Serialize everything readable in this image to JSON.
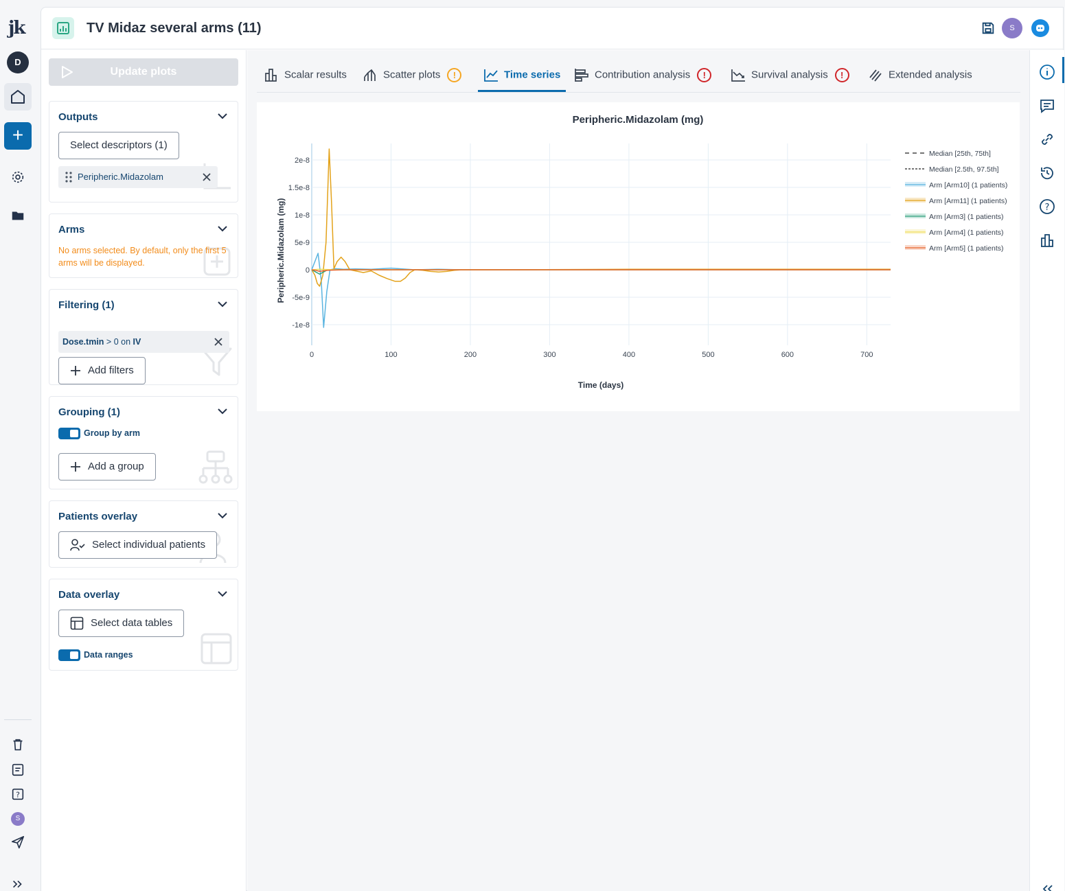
{
  "rail": {
    "logo": "jk",
    "user_initial": "D",
    "footer_user_initial": "S"
  },
  "header": {
    "title": "TV Midaz several arms (11)",
    "user_initial": "S"
  },
  "sidebar": {
    "update_label": "Update plots",
    "outputs": {
      "title": "Outputs",
      "select_label": "Select descriptors (1)",
      "chip": "Peripheric.Midazolam"
    },
    "arms": {
      "title": "Arms",
      "warning": "No arms selected. By default, only the first 5 arms will be displayed."
    },
    "filtering": {
      "title": "Filtering (1)",
      "filter_field": "Dose.tmin",
      "filter_op": "> 0 on",
      "filter_value": "IV",
      "add_label": "Add filters"
    },
    "grouping": {
      "title": "Grouping (1)",
      "toggle_label": "Group by arm",
      "add_label": "Add a group"
    },
    "patients_overlay": {
      "title": "Patients overlay",
      "select_label": "Select individual patients"
    },
    "data_overlay": {
      "title": "Data overlay",
      "select_label": "Select data tables",
      "toggle_label": "Data ranges"
    }
  },
  "tabs": [
    {
      "label": "Scalar results",
      "badge": ""
    },
    {
      "label": "Scatter plots",
      "badge": "!"
    },
    {
      "label": "Time series",
      "badge": ""
    },
    {
      "label": "Contribution analysis",
      "badge": "!"
    },
    {
      "label": "Survival analysis",
      "badge": "!"
    },
    {
      "label": "Extended analysis",
      "badge": ""
    }
  ],
  "colors": {
    "accent": "#0b6bad",
    "warning": "#f5a623",
    "error": "#d0262a",
    "arm10": "#5ab4e0",
    "arm11": "#e3a21a",
    "arm3": "#2ca07c",
    "arm4": "#f0dd5a",
    "arm5": "#e8632b"
  },
  "chart_data": {
    "type": "line",
    "title": "Peripheric.Midazolam (mg)",
    "xlabel": "Time (days)",
    "ylabel": "Peripheric.Midazolam (mg)",
    "xlim": [
      0,
      730
    ],
    "ylim": [
      -1.3e-08,
      2.3e-08
    ],
    "xticks": [
      0,
      100,
      200,
      300,
      400,
      500,
      600,
      700
    ],
    "xtick_labels": [
      "0",
      "100",
      "200",
      "300",
      "400",
      "500",
      "600",
      "700"
    ],
    "yticks": [
      2e-08,
      1.5e-08,
      1e-08,
      5e-09,
      0,
      -5e-09,
      -1e-08
    ],
    "ytick_labels": [
      "2e-8",
      "1.5e-8",
      "1e-8",
      "5e-9",
      "0",
      "-5e-9",
      "-1e-8"
    ],
    "grid": true,
    "legend_position": "right",
    "legend": [
      {
        "label": "Median [25th, 75th]",
        "style": "dash",
        "color": "#222222"
      },
      {
        "label": "Median [2.5th, 97.5th]",
        "style": "dot",
        "color": "#222222"
      },
      {
        "label": "Arm [Arm10] (1 patients)",
        "style": "solid",
        "color": "#5ab4e0"
      },
      {
        "label": "Arm [Arm11] (1 patients)",
        "style": "solid",
        "color": "#e3a21a"
      },
      {
        "label": "Arm [Arm3] (1 patients)",
        "style": "solid",
        "color": "#2ca07c"
      },
      {
        "label": "Arm [Arm4] (1 patients)",
        "style": "solid",
        "color": "#f0dd5a"
      },
      {
        "label": "Arm [Arm5] (1 patients)",
        "style": "solid",
        "color": "#e8632b"
      }
    ],
    "series": [
      {
        "name": "Arm [Arm10] (1 patients)",
        "color": "#5ab4e0",
        "x": [
          0,
          4,
          8,
          12,
          15,
          19,
          23,
          30,
          40,
          55,
          75,
          100,
          130,
          160,
          190,
          250,
          400,
          730
        ],
        "y": [
          0,
          1.5e-09,
          3e-09,
          -2e-09,
          -1.05e-08,
          -4e-09,
          0,
          2e-10,
          1e-10,
          1.5e-10,
          1e-10,
          3e-10,
          0,
          1e-10,
          0,
          0,
          0,
          0
        ]
      },
      {
        "name": "Arm [Arm11] (1 patients)",
        "color": "#e3a21a",
        "x": [
          0,
          4,
          7,
          10,
          14,
          18,
          22,
          25,
          28,
          32,
          37,
          42,
          48,
          55,
          65,
          75,
          85,
          95,
          105,
          112,
          118,
          124,
          130,
          140,
          150,
          160,
          170,
          180,
          190,
          200,
          250,
          400,
          600,
          730
        ],
        "y": [
          0,
          -1e-09,
          -2.5e-09,
          -3e-09,
          -1e-09,
          5e-09,
          2.2e-08,
          1.2e-08,
          2e-10,
          1.5e-09,
          2.3e-09,
          1.5e-09,
          0,
          -2e-10,
          -5e-10,
          -2e-10,
          -1e-09,
          -1.6e-09,
          -2.1e-09,
          -2.1e-09,
          -1.5e-09,
          -5e-10,
          0,
          -1e-10,
          -3e-10,
          -4e-10,
          -3e-10,
          -1e-10,
          0,
          0,
          0,
          1e-10,
          1e-10,
          1e-10
        ]
      },
      {
        "name": "Arm [Arm3] (1 patients)",
        "color": "#2ca07c",
        "x": [
          0,
          5,
          10,
          15,
          20,
          30,
          60,
          730
        ],
        "y": [
          0,
          -4e-10,
          -8e-10,
          -4e-10,
          0,
          0,
          0,
          0
        ]
      },
      {
        "name": "Arm [Arm4] (1 patients)",
        "color": "#f0dd5a",
        "x": [
          0,
          10,
          30,
          60,
          200,
          730
        ],
        "y": [
          0,
          1e-10,
          0,
          0,
          0,
          0
        ]
      },
      {
        "name": "Arm [Arm5] (1 patients)",
        "color": "#e8632b",
        "x": [
          0,
          5,
          10,
          20,
          40,
          100,
          400,
          730
        ],
        "y": [
          0,
          -1e-10,
          -3e-10,
          -1e-10,
          0,
          0,
          0,
          0
        ]
      }
    ]
  }
}
